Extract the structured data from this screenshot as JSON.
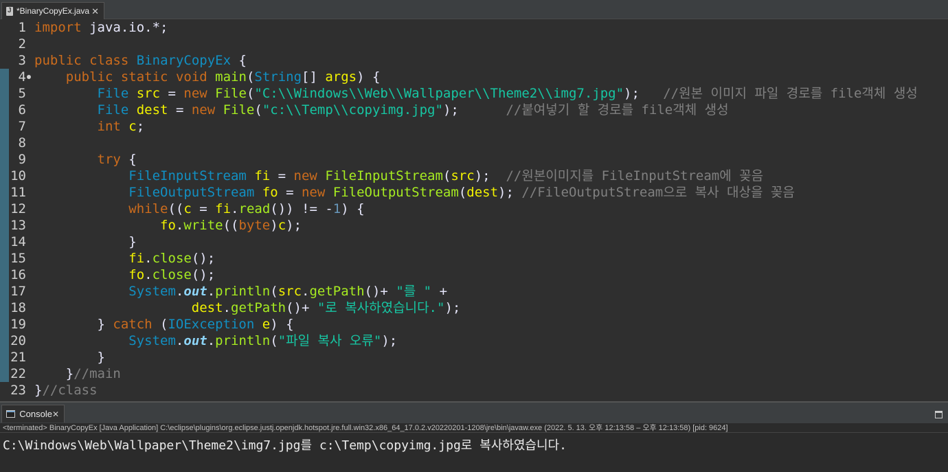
{
  "editor": {
    "tab_title": "*BinaryCopyEx.java",
    "lines": [
      {
        "n": "1",
        "tokens": [
          [
            "kw",
            "import"
          ],
          [
            "pl",
            " java.io.*;"
          ]
        ]
      },
      {
        "n": "2",
        "tokens": []
      },
      {
        "n": "3",
        "tokens": [
          [
            "kw",
            "public"
          ],
          [
            "pl",
            " "
          ],
          [
            "kw",
            "class"
          ],
          [
            "pl",
            " "
          ],
          [
            "cls",
            "BinaryCopyEx"
          ],
          [
            "pl",
            " {"
          ]
        ]
      },
      {
        "n": "4",
        "dot": true,
        "tokens": [
          [
            "pl",
            "    "
          ],
          [
            "kw",
            "public"
          ],
          [
            "pl",
            " "
          ],
          [
            "kw",
            "static"
          ],
          [
            "pl",
            " "
          ],
          [
            "kw",
            "void"
          ],
          [
            "pl",
            " "
          ],
          [
            "fn",
            "main"
          ],
          [
            "pl",
            "("
          ],
          [
            "cls",
            "String"
          ],
          [
            "pl",
            "[] "
          ],
          [
            "var",
            "args"
          ],
          [
            "pl",
            ") {"
          ]
        ]
      },
      {
        "n": "5",
        "tokens": [
          [
            "pl",
            "        "
          ],
          [
            "cls",
            "File"
          ],
          [
            "pl",
            " "
          ],
          [
            "var",
            "src"
          ],
          [
            "pl",
            " = "
          ],
          [
            "kw",
            "new"
          ],
          [
            "pl",
            " "
          ],
          [
            "fn",
            "File"
          ],
          [
            "pl",
            "("
          ],
          [
            "str",
            "\"C:\\\\Windows\\\\Web\\\\Wallpaper\\\\Theme2\\\\img7.jpg\""
          ],
          [
            "pl",
            ");   "
          ],
          [
            "cm",
            "//원본 이미지 파일 경로를 file객체 생성"
          ]
        ]
      },
      {
        "n": "6",
        "tokens": [
          [
            "pl",
            "        "
          ],
          [
            "cls",
            "File"
          ],
          [
            "pl",
            " "
          ],
          [
            "var",
            "dest"
          ],
          [
            "pl",
            " = "
          ],
          [
            "kw",
            "new"
          ],
          [
            "pl",
            " "
          ],
          [
            "fn",
            "File"
          ],
          [
            "pl",
            "("
          ],
          [
            "str",
            "\"c:\\\\Temp\\\\copyimg.jpg\""
          ],
          [
            "pl",
            ");      "
          ],
          [
            "cm",
            "//붙여넣기 할 경로를 file객체 생성"
          ]
        ]
      },
      {
        "n": "7",
        "tokens": [
          [
            "pl",
            "        "
          ],
          [
            "kw",
            "int"
          ],
          [
            "pl",
            " "
          ],
          [
            "var",
            "c"
          ],
          [
            "pl",
            ";"
          ]
        ]
      },
      {
        "n": "8",
        "tokens": []
      },
      {
        "n": "9",
        "tokens": [
          [
            "pl",
            "        "
          ],
          [
            "kw",
            "try"
          ],
          [
            "pl",
            " {"
          ]
        ]
      },
      {
        "n": "10",
        "tokens": [
          [
            "pl",
            "            "
          ],
          [
            "cls",
            "FileInputStream"
          ],
          [
            "pl",
            " "
          ],
          [
            "var",
            "fi"
          ],
          [
            "pl",
            " = "
          ],
          [
            "kw",
            "new"
          ],
          [
            "pl",
            " "
          ],
          [
            "fn",
            "FileInputStream"
          ],
          [
            "pl",
            "("
          ],
          [
            "var",
            "src"
          ],
          [
            "pl",
            ");  "
          ],
          [
            "cm",
            "//원본이미지를 FileInputStream에 꽂음"
          ]
        ]
      },
      {
        "n": "11",
        "tokens": [
          [
            "pl",
            "            "
          ],
          [
            "cls",
            "FileOutputStream"
          ],
          [
            "pl",
            " "
          ],
          [
            "var",
            "fo"
          ],
          [
            "pl",
            " = "
          ],
          [
            "kw",
            "new"
          ],
          [
            "pl",
            " "
          ],
          [
            "fn",
            "FileOutputStream"
          ],
          [
            "pl",
            "("
          ],
          [
            "var",
            "dest"
          ],
          [
            "pl",
            "); "
          ],
          [
            "cm",
            "//FileOutputStream으로 복사 대상을 꽂음"
          ]
        ]
      },
      {
        "n": "12",
        "tokens": [
          [
            "pl",
            "            "
          ],
          [
            "kw",
            "while"
          ],
          [
            "pl",
            "(("
          ],
          [
            "var",
            "c"
          ],
          [
            "pl",
            " = "
          ],
          [
            "var",
            "fi"
          ],
          [
            "pl",
            "."
          ],
          [
            "fn",
            "read"
          ],
          [
            "pl",
            "()) != -"
          ],
          [
            "num",
            "1"
          ],
          [
            "pl",
            ") {"
          ]
        ]
      },
      {
        "n": "13",
        "tokens": [
          [
            "pl",
            "                "
          ],
          [
            "var",
            "fo"
          ],
          [
            "pl",
            "."
          ],
          [
            "fn",
            "write"
          ],
          [
            "pl",
            "(("
          ],
          [
            "kw",
            "byte"
          ],
          [
            "pl",
            ")"
          ],
          [
            "var",
            "c"
          ],
          [
            "pl",
            ");"
          ]
        ]
      },
      {
        "n": "14",
        "tokens": [
          [
            "pl",
            "            }"
          ]
        ]
      },
      {
        "n": "15",
        "tokens": [
          [
            "pl",
            "            "
          ],
          [
            "var",
            "fi"
          ],
          [
            "pl",
            "."
          ],
          [
            "fn",
            "close"
          ],
          [
            "pl",
            "();"
          ]
        ]
      },
      {
        "n": "16",
        "tokens": [
          [
            "pl",
            "            "
          ],
          [
            "var",
            "fo"
          ],
          [
            "pl",
            "."
          ],
          [
            "fn",
            "close"
          ],
          [
            "pl",
            "();"
          ]
        ]
      },
      {
        "n": "17",
        "tokens": [
          [
            "pl",
            "            "
          ],
          [
            "cls",
            "System"
          ],
          [
            "pl",
            "."
          ],
          [
            "st",
            "out"
          ],
          [
            "pl",
            "."
          ],
          [
            "fn",
            "println"
          ],
          [
            "pl",
            "("
          ],
          [
            "var",
            "src"
          ],
          [
            "pl",
            "."
          ],
          [
            "fn",
            "getPath"
          ],
          [
            "pl",
            "()+ "
          ],
          [
            "str",
            "\"를 \""
          ],
          [
            "pl",
            " +"
          ]
        ]
      },
      {
        "n": "18",
        "tokens": [
          [
            "pl",
            "                    "
          ],
          [
            "var",
            "dest"
          ],
          [
            "pl",
            "."
          ],
          [
            "fn",
            "getPath"
          ],
          [
            "pl",
            "()+ "
          ],
          [
            "str",
            "\"로 복사하였습니다.\""
          ],
          [
            "pl",
            ");"
          ]
        ]
      },
      {
        "n": "19",
        "tokens": [
          [
            "pl",
            "        } "
          ],
          [
            "kw",
            "catch"
          ],
          [
            "pl",
            " ("
          ],
          [
            "cls",
            "IOException"
          ],
          [
            "pl",
            " "
          ],
          [
            "var",
            "e"
          ],
          [
            "pl",
            ") {"
          ]
        ]
      },
      {
        "n": "20",
        "tokens": [
          [
            "pl",
            "            "
          ],
          [
            "cls",
            "System"
          ],
          [
            "pl",
            "."
          ],
          [
            "st",
            "out"
          ],
          [
            "pl",
            "."
          ],
          [
            "fn",
            "println"
          ],
          [
            "pl",
            "("
          ],
          [
            "str",
            "\"파일 복사 오류\""
          ],
          [
            "pl",
            ");"
          ]
        ]
      },
      {
        "n": "21",
        "tokens": [
          [
            "pl",
            "        }"
          ]
        ]
      },
      {
        "n": "22",
        "tokens": [
          [
            "pl",
            "    }"
          ],
          [
            "cm",
            "//main"
          ]
        ]
      },
      {
        "n": "23",
        "tokens": [
          [
            "pl",
            "}"
          ],
          [
            "cm",
            "//class"
          ]
        ]
      }
    ]
  },
  "console": {
    "tab_title": "Console",
    "status": "<terminated> BinaryCopyEx [Java Application] C:\\eclipse\\plugins\\org.eclipse.justj.openjdk.hotspot.jre.full.win32.x86_64_17.0.2.v20220201-1208\\jre\\bin\\javaw.exe  (2022. 5. 13. 오후 12:13:58 – 오후 12:13:58) [pid: 9624]",
    "output": "C:\\Windows\\Web\\Wallpaper\\Theme2\\img7.jpg를 c:\\Temp\\copyimg.jpg로 복사하였습니다."
  }
}
